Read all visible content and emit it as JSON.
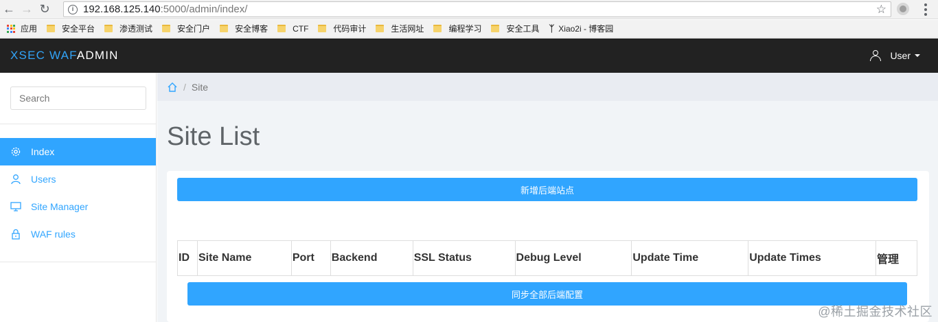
{
  "browser": {
    "url_host": "192.168.125.140",
    "url_rest": ":5000/admin/index/",
    "bookmarks": [
      "应用",
      "安全平台",
      "渗透测试",
      "安全门户",
      "安全博客",
      "CTF",
      "代码审计",
      "生活网址",
      "编程学习",
      "安全工具",
      "Xiao2i - 博客园"
    ]
  },
  "navbar": {
    "brand_part1": "XSEC WAF",
    "brand_part2": "ADMIN",
    "user_label": "User"
  },
  "sidebar": {
    "search_placeholder": "Search",
    "items": [
      {
        "label": "Index",
        "icon": "gear-icon",
        "active": true
      },
      {
        "label": "Users",
        "icon": "user-icon",
        "active": false
      },
      {
        "label": "Site Manager",
        "icon": "monitor-icon",
        "active": false
      },
      {
        "label": "WAF rules",
        "icon": "lock-icon",
        "active": false
      }
    ]
  },
  "main": {
    "breadcrumb": "Site",
    "title": "Site List",
    "add_button": "新增后端站点",
    "sync_button": "同步全部后端配置",
    "table_headers": [
      "ID",
      "Site Name",
      "Port",
      "Backend",
      "SSL Status",
      "Debug Level",
      "Update Time",
      "Update Times",
      "管理"
    ]
  },
  "watermark": "@稀土掘金技术社区",
  "colors": {
    "accent": "#30a5ff",
    "navbar": "#222222",
    "main_bg": "#f1f4f7"
  }
}
